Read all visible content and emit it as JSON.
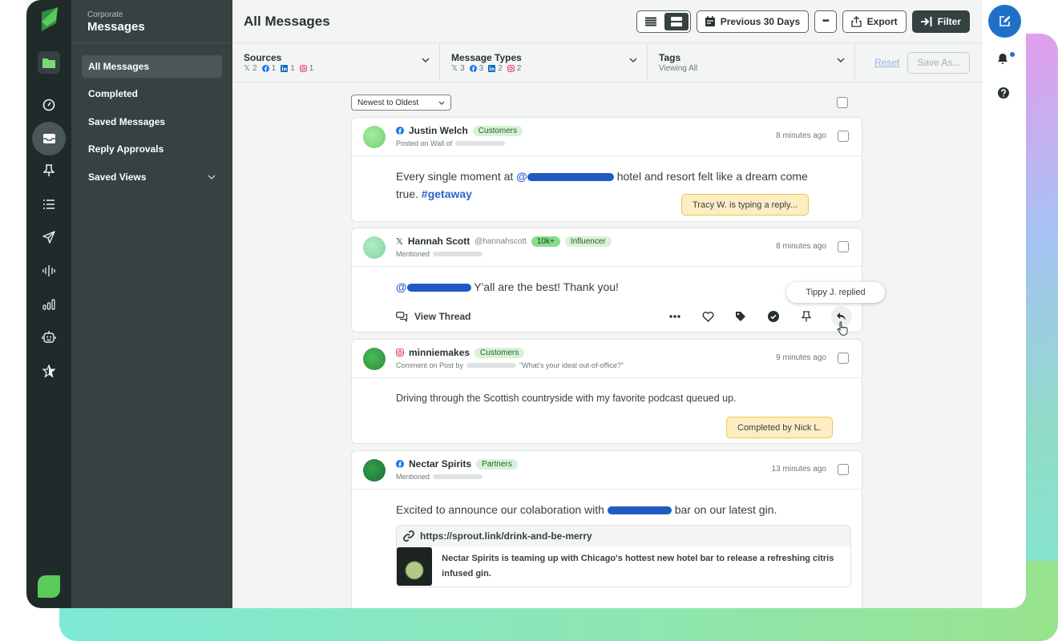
{
  "nav": {
    "workspace": "Corporate",
    "title": "Messages",
    "items": [
      {
        "label": "All Messages",
        "active": true
      },
      {
        "label": "Completed"
      },
      {
        "label": "Saved Messages"
      },
      {
        "label": "Reply Approvals"
      },
      {
        "label": "Saved Views",
        "expandable": true
      }
    ]
  },
  "rail": {
    "icons": [
      "sprout-logo",
      "folder-icon",
      "gauge-icon",
      "inbox-icon",
      "pin-icon",
      "list-icon",
      "send-icon",
      "listening-icon",
      "reports-icon",
      "bot-icon",
      "star-icon",
      "leaf-icon"
    ]
  },
  "header": {
    "title": "All Messages",
    "date_range": "Previous 30 Days",
    "more_label": "•••",
    "export_label": "Export",
    "filter_label": "Filter"
  },
  "filters": {
    "sources": {
      "label": "Sources",
      "counts": {
        "x": "2",
        "facebook": "1",
        "linkedin": "1",
        "instagram": "1"
      }
    },
    "message_types": {
      "label": "Message Types",
      "counts": {
        "x": "3",
        "facebook": "3",
        "linkedin": "2",
        "instagram": "2"
      }
    },
    "tags": {
      "label": "Tags",
      "value": "Viewing All"
    },
    "reset_label": "Reset",
    "save_as_label": "Save As..."
  },
  "sort": {
    "selected": "Newest to Oldest"
  },
  "messages": [
    {
      "network": "facebook",
      "name": "Justin Welch",
      "tags": [
        "Customers"
      ],
      "meta": "Posted on Wall of",
      "time": "8 minutes ago",
      "text_pre": "Every single moment at ",
      "mention": "@",
      "text_post": " hotel and resort felt like a dream come",
      "text_line2": "true. ",
      "hashtag": "#getaway",
      "status_note": "Tracy W. is typing a reply..."
    },
    {
      "network": "x",
      "name": "Hannah Scott",
      "handle": "@hannahscott",
      "tags": [
        "10k+",
        "Influencer"
      ],
      "meta": "Mentioned",
      "time": "8 minutes ago",
      "mention": "@",
      "text_post": " Y'all are the best! Thank you!",
      "view_thread_label": "View Thread",
      "tooltip": "Tippy J. replied"
    },
    {
      "network": "instagram",
      "name": "minniemakes",
      "tags": [
        "Customers"
      ],
      "meta": "Comment on Post by",
      "meta_quote": "\"What's your ideal out-of-office?\"",
      "time": "9 minutes ago",
      "text": "Driving through the Scottish countryside with my favorite podcast queued up.",
      "status_note": "Completed by Nick L."
    },
    {
      "network": "facebook",
      "name": "Nectar Spirits",
      "tags": [
        "Partners"
      ],
      "meta": "Mentioned",
      "time": "13 minutes ago",
      "text_pre": "Excited to announce our colaboration with ",
      "text_post": " bar on our latest gin.",
      "link_url": "https://sprout.link/drink-and-be-merry",
      "link_desc": "Nectar Spirits is teaming up with Chicago's hottest new hotel bar to release a refreshing citris infused gin."
    }
  ],
  "colors": {
    "rail": "#212a2b",
    "nav": "#364141",
    "accent_blue": "#1f71c8",
    "mention_blue": "#2c64cc",
    "tag_green": "#d6f3d5",
    "note_yellow": "#fdedc3"
  }
}
